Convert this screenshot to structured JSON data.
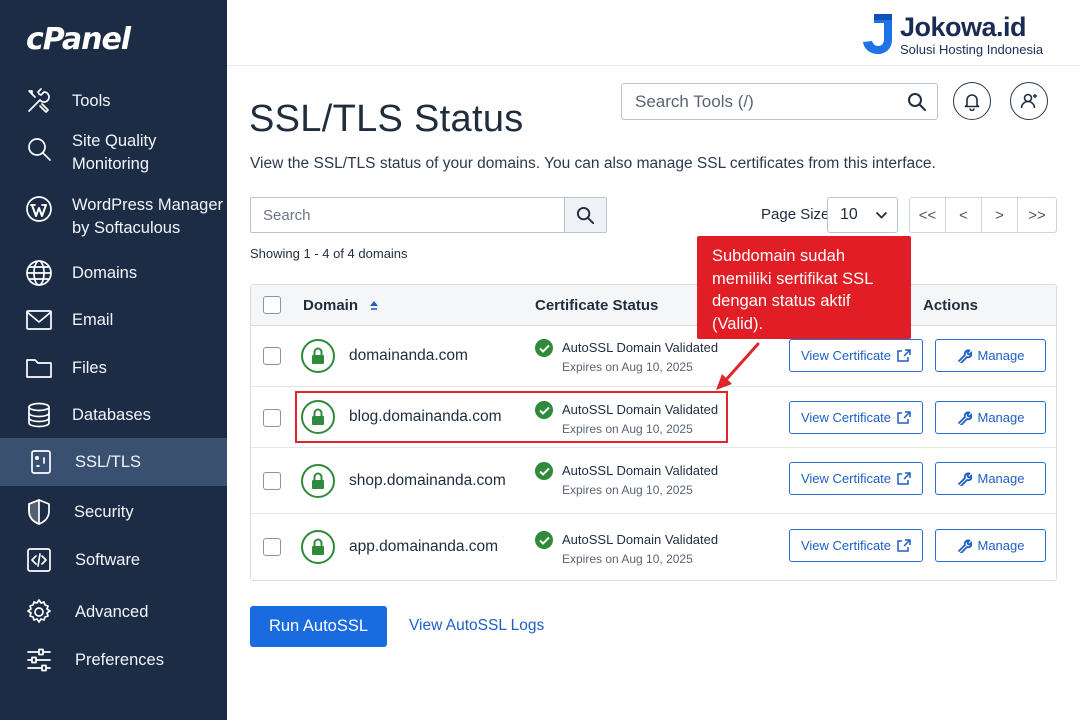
{
  "sidebar": {
    "logo": "cPanel",
    "items": [
      {
        "label": "Tools",
        "icon": "tools-icon"
      },
      {
        "label": "Site Quality\nMonitoring",
        "icon": "magnifier-icon"
      },
      {
        "label": "WordPress Manager\nby Softaculous",
        "icon": "wordpress-icon"
      },
      {
        "label": "Domains",
        "icon": "globe-icon"
      },
      {
        "label": "Email",
        "icon": "envelope-icon"
      },
      {
        "label": "Files",
        "icon": "folder-icon"
      },
      {
        "label": "Databases",
        "icon": "database-icon"
      },
      {
        "label": "SSL/TLS",
        "icon": "certificate-icon",
        "active": true
      },
      {
        "label": "Security",
        "icon": "shield-icon"
      },
      {
        "label": "Software",
        "icon": "code-icon"
      },
      {
        "label": "Advanced",
        "icon": "gear-icon"
      },
      {
        "label": "Preferences",
        "icon": "sliders-icon"
      }
    ]
  },
  "brand": {
    "name": "Jokowa.id",
    "tagline": "Solusi Hosting Indonesia"
  },
  "header": {
    "search_placeholder": "Search Tools (/)"
  },
  "page": {
    "title": "SSL/TLS Status",
    "description": "View the SSL/TLS status of your domains. You can also manage SSL certificates from this interface.",
    "search_placeholder": "Search",
    "page_size_label": "Page Size",
    "page_size_value": "10",
    "pager": [
      "<<",
      "<",
      ">",
      ">>"
    ],
    "showing": "Showing 1 - 4 of 4 domains"
  },
  "table": {
    "headers": {
      "domain": "Domain",
      "status": "Certificate Status",
      "actions": "Actions"
    },
    "rows": [
      {
        "domain": "domainanda.com",
        "status": "AutoSSL Domain Validated",
        "expires": "Expires on Aug 10, 2025"
      },
      {
        "domain": "blog.domainanda.com",
        "status": "AutoSSL Domain Validated",
        "expires": "Expires on Aug 10, 2025"
      },
      {
        "domain": "shop.domainanda.com",
        "status": "AutoSSL Domain Validated",
        "expires": "Expires on Aug 10, 2025"
      },
      {
        "domain": "app.domainanda.com",
        "status": "AutoSSL Domain Validated",
        "expires": "Expires on Aug 10, 2025"
      }
    ],
    "view_label": "View Certificate",
    "manage_label": "Manage"
  },
  "callout": {
    "text": "Subdomain sudah memiliki sertifikat SSL dengan status aktif (Valid).",
    "color": "#e11d25"
  },
  "footer": {
    "run_label": "Run AutoSSL",
    "logs_label": "View AutoSSL Logs"
  },
  "colors": {
    "sidebar": "#1c2c45",
    "active": "#3a5070",
    "primary": "#1a6be0",
    "success": "#2f8a3b",
    "highlight": "#e0262b"
  }
}
